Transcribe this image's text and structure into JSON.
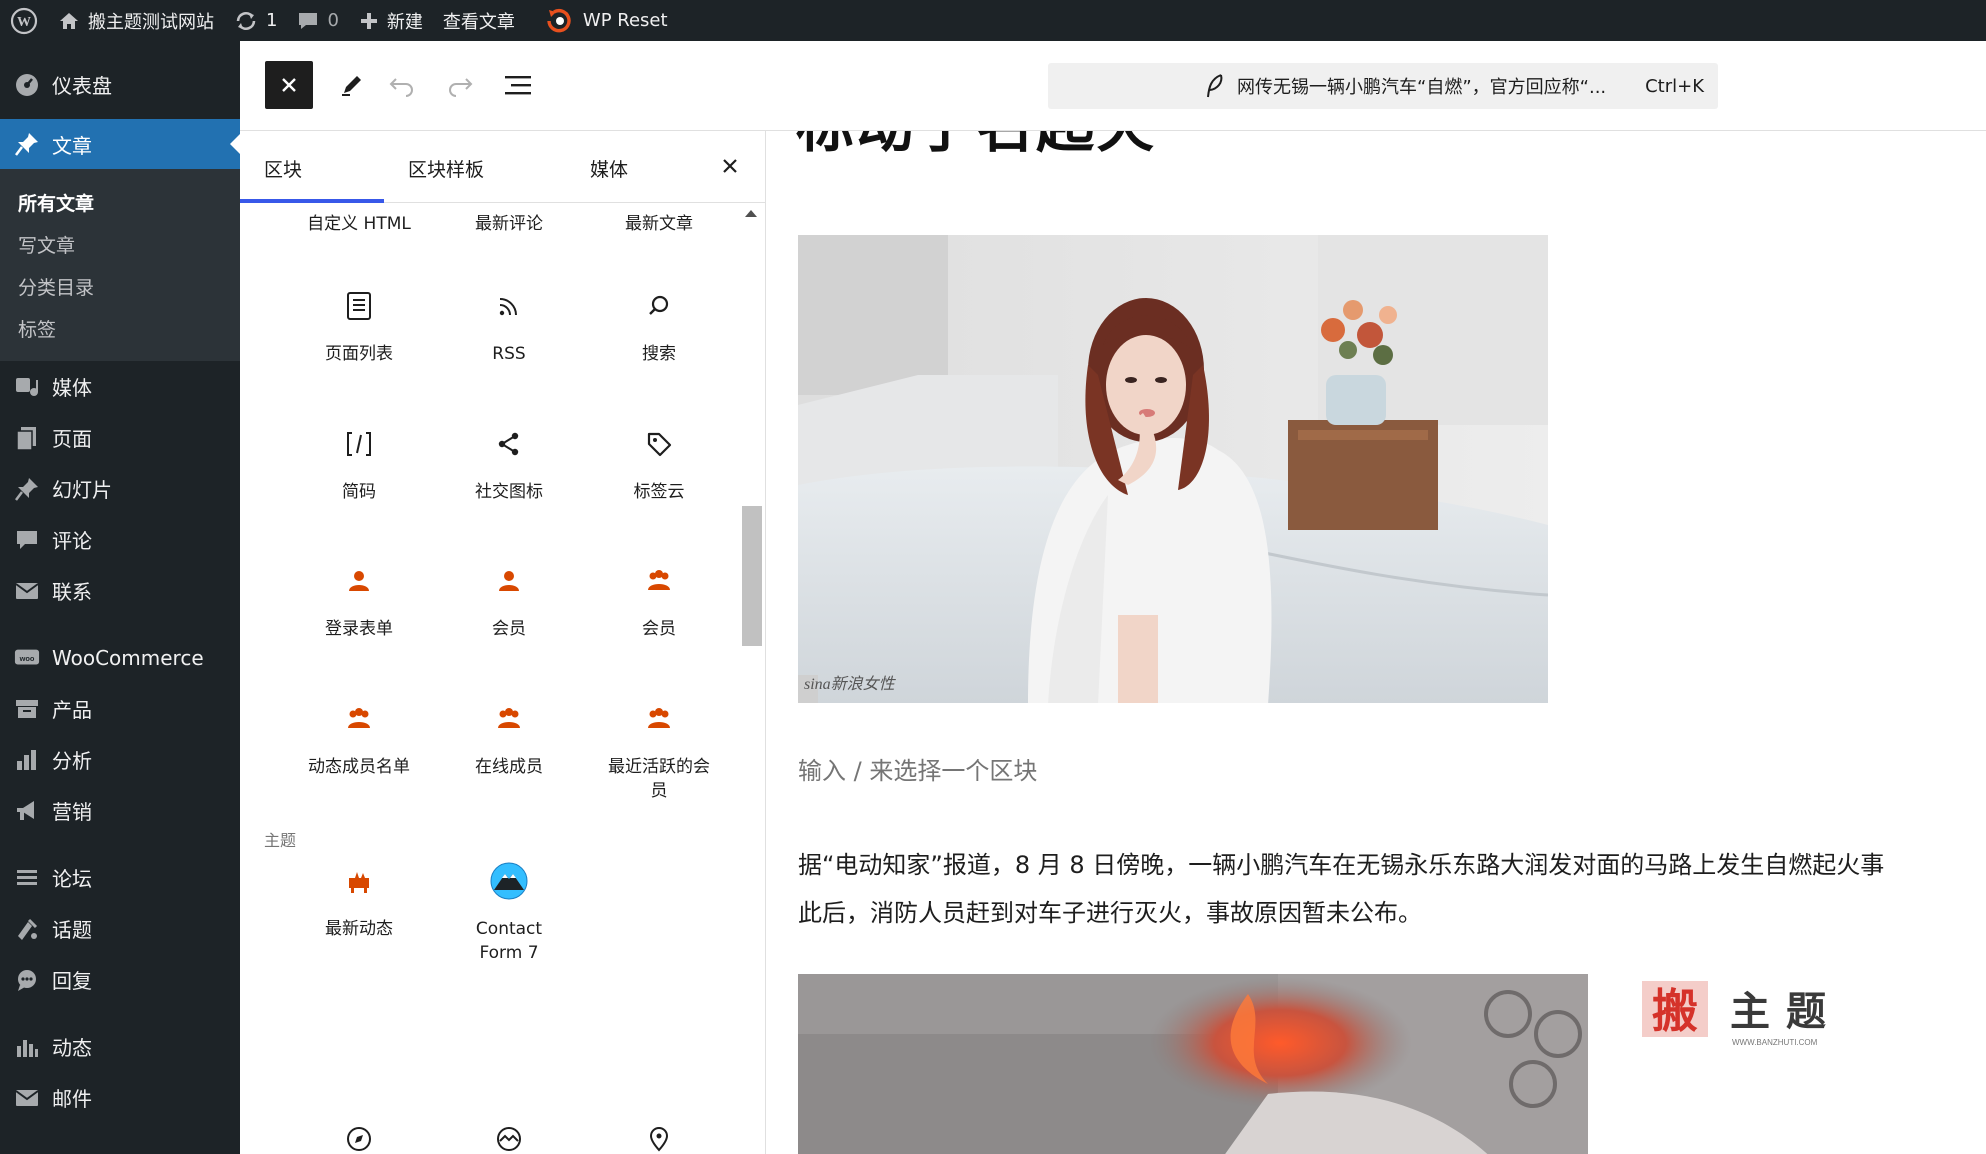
{
  "admin_bar": {
    "site_name": "搬主题测试网站",
    "updates_count": "1",
    "comments_count": "0",
    "new_label": "新建",
    "view_post_label": "查看文章",
    "wp_reset_label": "WP Reset"
  },
  "sidebar": {
    "items": [
      {
        "label": "仪表盘",
        "icon": "dashboard-icon"
      },
      {
        "label": "文章",
        "icon": "pin-icon",
        "active": true
      },
      {
        "label": "媒体",
        "icon": "media-icon"
      },
      {
        "label": "页面",
        "icon": "page-icon"
      },
      {
        "label": "幻灯片",
        "icon": "pin-icon"
      },
      {
        "label": "评论",
        "icon": "comment-icon"
      },
      {
        "label": "联系",
        "icon": "mail-icon"
      },
      {
        "label": "WooCommerce",
        "icon": "woo-icon"
      },
      {
        "label": "产品",
        "icon": "archive-icon"
      },
      {
        "label": "分析",
        "icon": "chart-icon"
      },
      {
        "label": "营销",
        "icon": "megaphone-icon"
      },
      {
        "label": "论坛",
        "icon": "forum-icon"
      },
      {
        "label": "话题",
        "icon": "topic-icon"
      },
      {
        "label": "回复",
        "icon": "reply-icon"
      },
      {
        "label": "动态",
        "icon": "activity-icon"
      },
      {
        "label": "邮件",
        "icon": "mail-icon"
      }
    ],
    "submenu": [
      "所有文章",
      "写文章",
      "分类目录",
      "标签"
    ]
  },
  "toolbar": {
    "command_title": "网传无锡一辆小鹏汽车“自燃”，官方回应称“...",
    "shortcut": "Ctrl+K"
  },
  "inserter": {
    "tabs": [
      "区块",
      "区块样板",
      "媒体"
    ],
    "top_labels": [
      "自定义 HTML",
      "最新评论",
      "最新文章"
    ],
    "blocks": [
      {
        "label": "页面列表",
        "icon": "page-list-icon"
      },
      {
        "label": "RSS",
        "icon": "rss-icon"
      },
      {
        "label": "搜索",
        "icon": "search-icon"
      },
      {
        "label": "简码",
        "icon": "shortcode-icon"
      },
      {
        "label": "社交图标",
        "icon": "share-icon"
      },
      {
        "label": "标签云",
        "icon": "tag-icon"
      },
      {
        "label": "登录表单",
        "icon": "user-icon"
      },
      {
        "label": "会员",
        "icon": "user-icon"
      },
      {
        "label": "会员",
        "icon": "group-icon"
      },
      {
        "label": "动态成员名单",
        "icon": "group-icon"
      },
      {
        "label": "在线成员",
        "icon": "group-icon"
      },
      {
        "label": "最近活跃的会员",
        "icon": "group-icon"
      },
      {
        "label": "最新动态",
        "icon": "activity-icon"
      },
      {
        "label": "Contact Form 7",
        "icon": "mountain-icon"
      }
    ],
    "category_theme": "主题"
  },
  "canvas": {
    "cut_title": "标动了名起火",
    "photo_credit": "sina新浪女性",
    "placeholder": "输入 / 来选择一个区块",
    "paragraph_line1": "据“电动知家”报道，8 月 8 日傍晚，一辆小鹏汽车在无锡永乐东路大润发对面的马路上发生自燃起火事",
    "paragraph_line2": "此后，消防人员赶到对车子进行灭火，事故原因暂未公布。",
    "watermark_text": "主题",
    "watermark_url": "WWW.BANZHUTI.COM"
  },
  "colors": {
    "admin_bg": "#1d2327",
    "active_blue": "#2271b1",
    "tab_accent": "#3858e9",
    "buddypress_orange": "#d84800"
  }
}
